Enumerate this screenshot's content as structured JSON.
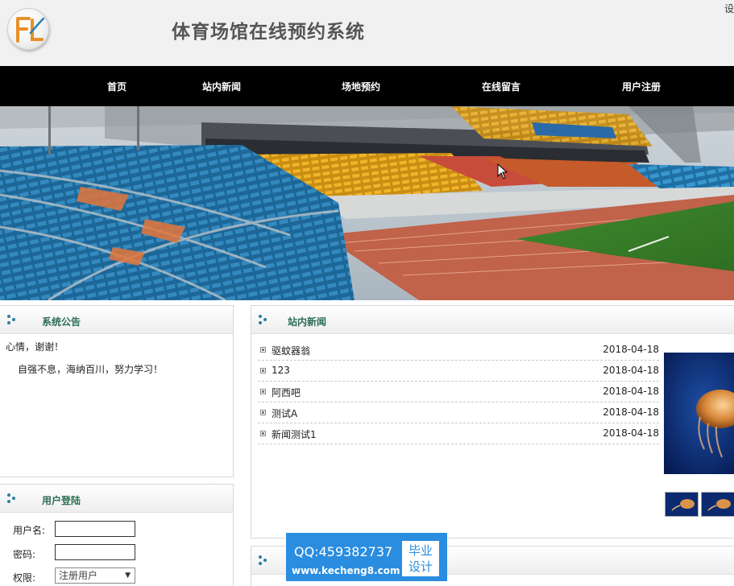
{
  "header": {
    "title": "体育场馆在线预约系统",
    "logo_text": "FL",
    "corner_text": "设"
  },
  "nav": {
    "items": [
      {
        "label": "首页"
      },
      {
        "label": "站内新闻"
      },
      {
        "label": "场地预约"
      },
      {
        "label": "在线留言"
      },
      {
        "label": "用户注册"
      }
    ]
  },
  "notice": {
    "title": "系统公告",
    "line1": "心情，谢谢！",
    "line2": "自强不息，海纳百川，努力学习！"
  },
  "login": {
    "title": "用户登陆",
    "username_label": "用户名:",
    "password_label": "密码:",
    "role_label": "权限:",
    "role_value": "注册用户"
  },
  "news": {
    "title": "站内新闻",
    "items": [
      {
        "title": "驱蚊器翁",
        "date": "2018-04-18"
      },
      {
        "title": "123",
        "date": "2018-04-18"
      },
      {
        "title": "阿西吧",
        "date": "2018-04-18"
      },
      {
        "title": "测试A",
        "date": "2018-04-18"
      },
      {
        "title": "新闻测试1",
        "date": "2018-04-18"
      }
    ]
  },
  "watermark": {
    "qq": "QQ:459382737",
    "url": "www.kecheng8.com",
    "badge_line1": "毕业",
    "badge_line2": "设计"
  },
  "colors": {
    "nav_bg": "#000000",
    "panel_title": "#2c6e54",
    "watermark_bg": "#2a8de0"
  }
}
